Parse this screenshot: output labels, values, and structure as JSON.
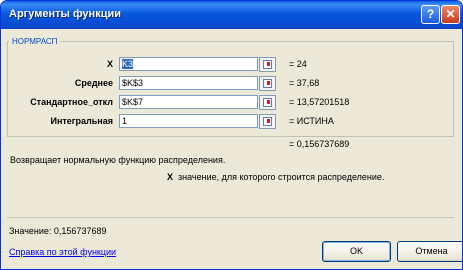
{
  "window": {
    "title": "Аргументы функции",
    "help_label": "?",
    "close_label": "✕"
  },
  "function": {
    "name": "НОРМРАСП",
    "args": [
      {
        "label": "X",
        "selected_text": "K3",
        "value": "= 24"
      },
      {
        "label": "Среднее",
        "input": "$K$3",
        "value": "= 37,68"
      },
      {
        "label": "Стандартное_откл",
        "input": "$K$7",
        "value": "= 13,57201518"
      },
      {
        "label": "Интегральная",
        "input": "1",
        "value": "= ИСТИНА"
      }
    ],
    "result": "= 0,156737689"
  },
  "description": "Возвращает нормальную функцию распределения.",
  "param_help": {
    "name": "X",
    "text": "значение, для которого строится распределение."
  },
  "footer": {
    "value_line": "Значение:  0,156737689",
    "help_link": "Справка по этой функции",
    "ok_label": "OK",
    "cancel_label": "Отмена"
  }
}
